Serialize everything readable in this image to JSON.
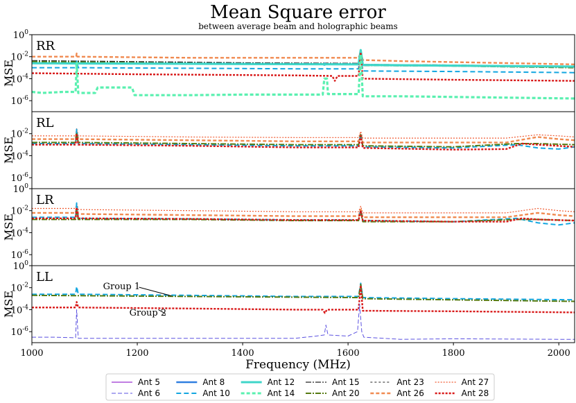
{
  "title": "Mean Square error",
  "subtitle": "between average beam and holographic beams",
  "chart_data": {
    "type": "line",
    "xlabel": "Frequency (MHz)",
    "ylabel": "MSE",
    "xlim": [
      1000,
      2030
    ],
    "ylim_log10": [
      -7,
      0
    ],
    "x_ticks": [
      1000,
      1200,
      1400,
      1600,
      1800,
      2000
    ],
    "x_tick_labels": [
      "1000",
      "1200",
      "1400",
      "1600",
      "1800",
      "2000"
    ],
    "y_tick_labels": [
      {
        "base": "10",
        "exp": "0"
      },
      {
        "base": "10",
        "exp": "-2"
      },
      {
        "base": "10",
        "exp": "-4"
      },
      {
        "base": "10",
        "exp": "-6"
      }
    ],
    "legend_position": "bottom-center",
    "legend": [
      {
        "key": "a5",
        "label": "Ant 5",
        "color": "#9b30d0",
        "dash": "",
        "width": 1.2
      },
      {
        "key": "a6",
        "label": "Ant 6",
        "color": "#5a50e0",
        "dash": "6,3",
        "width": 1.0
      },
      {
        "key": "a8",
        "label": "Ant 8",
        "color": "#2f7fe0",
        "dash": "",
        "width": 2.4
      },
      {
        "key": "a10",
        "label": "Ant 10",
        "color": "#12a6e0",
        "dash": "7,4",
        "width": 2.0
      },
      {
        "key": "a12",
        "label": "Ant 12",
        "color": "#3fd6c9",
        "dash": "",
        "width": 3.2
      },
      {
        "key": "a14",
        "label": "Ant 14",
        "color": "#5af0b0",
        "dash": "5,3",
        "width": 3.2
      },
      {
        "key": "a15",
        "label": "Ant 15",
        "color": "#222222",
        "dash": "8,2,2,2",
        "width": 1.2
      },
      {
        "key": "a20",
        "label": "Ant 20",
        "color": "#557a10",
        "dash": "8,2,2,2",
        "width": 2.0
      },
      {
        "key": "a23",
        "label": "Ant 23",
        "color": "#222222",
        "dash": "3,3",
        "width": 1.0
      },
      {
        "key": "a26",
        "label": "Ant 26",
        "color": "#f08a50",
        "dash": "5,3",
        "width": 2.4
      },
      {
        "key": "a27",
        "label": "Ant 27",
        "color": "#f05a30",
        "dash": "2,2",
        "width": 1.2
      },
      {
        "key": "a28",
        "label": "Ant 28",
        "color": "#d81818",
        "dash": "3,2",
        "width": 2.4
      }
    ],
    "panels": [
      {
        "label": "RR",
        "show_top_tick": true,
        "annotations": [],
        "series": [
          {
            "key": "a26",
            "x": [
              1000,
              1084,
              1085,
              1086,
              1300,
              1620,
              1624,
              1628,
              1700,
              2030
            ],
            "y": [
              -2.0,
              -2.0,
              -1.7,
              -2.0,
              -2.1,
              -2.1,
              -1.6,
              -2.3,
              -2.4,
              -2.7
            ]
          },
          {
            "key": "a15",
            "x": [
              1000,
              1200,
              1400,
              1620,
              1624,
              1628,
              1800,
              2030
            ],
            "y": [
              -2.35,
              -2.45,
              -2.55,
              -2.6,
              -1.7,
              -2.7,
              -2.75,
              -2.9
            ]
          },
          {
            "key": "a20",
            "x": [
              1000,
              1200,
              1400,
              1620,
              1624,
              1628,
              1800,
              2030
            ],
            "y": [
              -2.45,
              -2.55,
              -2.65,
              -2.7,
              -1.8,
              -2.8,
              -2.85,
              -3.0
            ]
          },
          {
            "key": "a10",
            "x": [
              1000,
              1083,
              1085,
              1088,
              1300,
              1500,
              1552,
              1556,
              1560,
              1620,
              1624,
              1628,
              1800,
              2030
            ],
            "y": [
              -3.0,
              -3.0,
              -2.4,
              -3.0,
              -3.05,
              -3.1,
              -3.1,
              -2.6,
              -3.1,
              -3.1,
              -1.6,
              -3.3,
              -3.35,
              -3.45
            ]
          },
          {
            "key": "a12",
            "x": [
              1000,
              1620,
              1624,
              1628,
              2030
            ],
            "y": [
              -2.6,
              -2.7,
              -1.4,
              -2.75,
              -2.9
            ]
          },
          {
            "key": "a28",
            "x": [
              1000,
              1200,
              1500,
              1570,
              1575,
              1580,
              1620,
              1624,
              1628,
              1800,
              2030
            ],
            "y": [
              -3.5,
              -3.6,
              -3.7,
              -3.75,
              -4.2,
              -3.75,
              -3.75,
              -1.6,
              -4.0,
              -4.1,
              -4.2
            ]
          },
          {
            "key": "a14",
            "x": [
              1000,
              1020,
              1060,
              1083,
              1085,
              1088,
              1120,
              1125,
              1190,
              1195,
              1300,
              1400,
              1500,
              1552,
              1555,
              1560,
              1562,
              1600,
              1620,
              1624,
              1628,
              1700,
              2030
            ],
            "y": [
              -5.2,
              -5.3,
              -5.2,
              -5.2,
              -2.6,
              -5.3,
              -5.3,
              -4.8,
              -4.8,
              -5.5,
              -5.5,
              -5.45,
              -5.45,
              -5.45,
              -4.0,
              -4.0,
              -5.4,
              -5.4,
              -5.4,
              -1.8,
              -5.6,
              -5.6,
              -5.8
            ]
          }
        ]
      },
      {
        "label": "RL",
        "show_top_tick": false,
        "annotations": [],
        "series": [
          {
            "key": "a27",
            "x": [
              1000,
              1083,
              1085,
              1088,
              1300,
              1500,
              1620,
              1624,
              1628,
              1800,
              1900,
              1960,
              2000,
              2030
            ],
            "y": [
              -2.2,
              -2.2,
              -1.5,
              -2.2,
              -2.3,
              -2.35,
              -2.35,
              -1.8,
              -2.4,
              -2.4,
              -2.4,
              -2.1,
              -2.2,
              -2.3
            ]
          },
          {
            "key": "a26",
            "x": [
              1000,
              1083,
              1085,
              1088,
              1300,
              1500,
              1620,
              1624,
              1628,
              1800,
              1900,
              1960,
              2000,
              2030
            ],
            "y": [
              -2.5,
              -2.5,
              -1.8,
              -2.5,
              -2.6,
              -2.7,
              -2.7,
              -2.0,
              -2.8,
              -2.8,
              -2.8,
              -2.3,
              -2.5,
              -2.6
            ]
          },
          {
            "key": "a10",
            "x": [
              1000,
              1083,
              1085,
              1088,
              1300,
              1500,
              1620,
              1624,
              1628,
              1800,
              1920,
              1960,
              2000,
              2030
            ],
            "y": [
              -2.9,
              -2.9,
              -1.6,
              -2.9,
              -3.0,
              -3.1,
              -3.1,
              -2.0,
              -3.2,
              -3.3,
              -3.0,
              -3.3,
              -3.4,
              -3.2
            ]
          },
          {
            "key": "a20",
            "x": [
              1000,
              1083,
              1085,
              1088,
              1300,
              1500,
              1620,
              1624,
              1628,
              1800,
              1920,
              1960,
              2030
            ],
            "y": [
              -2.8,
              -2.8,
              -2.0,
              -2.8,
              -2.9,
              -3.0,
              -3.0,
              -2.1,
              -3.1,
              -3.2,
              -2.9,
              -2.9,
              -3.0
            ]
          },
          {
            "key": "a28",
            "x": [
              1000,
              1083,
              1085,
              1088,
              1300,
              1500,
              1620,
              1624,
              1628,
              1800,
              1900,
              1930,
              1960,
              2030
            ],
            "y": [
              -3.0,
              -3.0,
              -2.0,
              -3.0,
              -3.1,
              -3.25,
              -3.25,
              -2.2,
              -3.3,
              -3.45,
              -3.4,
              -2.9,
              -3.0,
              -3.2
            ]
          }
        ]
      },
      {
        "label": "LR",
        "show_top_tick": true,
        "annotations": [],
        "series": [
          {
            "key": "a27",
            "x": [
              1000,
              1083,
              1085,
              1088,
              1300,
              1500,
              1620,
              1624,
              1628,
              1800,
              1900,
              1960,
              2000,
              2030
            ],
            "y": [
              -1.8,
              -1.8,
              -1.3,
              -1.9,
              -2.0,
              -2.1,
              -2.1,
              -1.6,
              -2.2,
              -2.2,
              -2.2,
              -1.8,
              -2.0,
              -2.1
            ]
          },
          {
            "key": "a26",
            "x": [
              1000,
              1083,
              1085,
              1088,
              1300,
              1500,
              1620,
              1624,
              1628,
              1800,
              1900,
              1960,
              2000,
              2030
            ],
            "y": [
              -2.2,
              -2.2,
              -1.6,
              -2.3,
              -2.4,
              -2.5,
              -2.5,
              -1.9,
              -2.6,
              -2.6,
              -2.6,
              -2.2,
              -2.4,
              -2.5
            ]
          },
          {
            "key": "a10",
            "x": [
              1000,
              1083,
              1085,
              1088,
              1300,
              1500,
              1620,
              1624,
              1628,
              1800,
              1920,
              1960,
              2000,
              2030
            ],
            "y": [
              -2.6,
              -2.6,
              -1.3,
              -2.7,
              -2.75,
              -2.85,
              -2.85,
              -1.9,
              -2.9,
              -3.0,
              -2.7,
              -3.1,
              -3.3,
              -3.1
            ]
          },
          {
            "key": "a20",
            "x": [
              1000,
              1083,
              1085,
              1088,
              1300,
              1500,
              1620,
              1624,
              1628,
              1800,
              1920,
              1960,
              2030
            ],
            "y": [
              -2.8,
              -2.8,
              -2.0,
              -2.8,
              -2.8,
              -2.9,
              -2.9,
              -2.1,
              -3.0,
              -3.0,
              -2.8,
              -2.8,
              -2.9
            ]
          },
          {
            "key": "a28",
            "x": [
              1000,
              1083,
              1085,
              1088,
              1300,
              1500,
              1620,
              1624,
              1628,
              1800,
              1900,
              1930,
              1960,
              2030
            ],
            "y": [
              -2.7,
              -2.7,
              -1.7,
              -2.7,
              -2.75,
              -2.85,
              -2.85,
              -2.0,
              -2.9,
              -3.0,
              -3.0,
              -2.7,
              -2.8,
              -2.9
            ]
          }
        ]
      },
      {
        "label": "LL",
        "show_top_tick": true,
        "annotations": [
          {
            "text": "Group 1",
            "x": 1135,
            "y": -2.15,
            "to_x": 1265,
            "to_y": -2.75
          },
          {
            "text": "Group 2",
            "x": 1185,
            "y": -4.55,
            "to_x": 1240,
            "to_y": -4.0
          }
        ],
        "series": [
          {
            "key": "a10",
            "x": [
              1000,
              1083,
              1085,
              1088,
              1300,
              1500,
              1620,
              1624,
              1628,
              1800,
              2030
            ],
            "y": [
              -2.6,
              -2.6,
              -1.9,
              -2.6,
              -2.7,
              -2.8,
              -2.8,
              -1.6,
              -2.9,
              -3.0,
              -3.1
            ]
          },
          {
            "key": "a20",
            "x": [
              1000,
              1300,
              1620,
              1624,
              1628,
              2030
            ],
            "y": [
              -2.7,
              -2.8,
              -2.9,
              -1.7,
              -3.0,
              -3.25
            ]
          },
          {
            "key": "a28",
            "x": [
              1000,
              1083,
              1085,
              1088,
              1300,
              1500,
              1552,
              1556,
              1560,
              1620,
              1624,
              1628,
              1800,
              2030
            ],
            "y": [
              -3.8,
              -3.8,
              -3.3,
              -3.8,
              -3.9,
              -4.0,
              -4.0,
              -4.3,
              -4.0,
              -4.0,
              -1.8,
              -4.1,
              -4.15,
              -4.25
            ]
          },
          {
            "key": "a6",
            "x": [
              1000,
              1040,
              1083,
              1085,
              1088,
              1300,
              1500,
              1540,
              1555,
              1558,
              1562,
              1600,
              1618,
              1622,
              1626,
              1630,
              1700,
              1800,
              2000,
              2030
            ],
            "y": [
              -6.5,
              -6.5,
              -6.55,
              -4.0,
              -6.6,
              -6.6,
              -6.6,
              -6.4,
              -6.3,
              -5.4,
              -6.3,
              -6.4,
              -6.0,
              -3.5,
              -6.0,
              -6.5,
              -6.7,
              -6.65,
              -6.7,
              -6.7
            ]
          }
        ]
      }
    ]
  }
}
